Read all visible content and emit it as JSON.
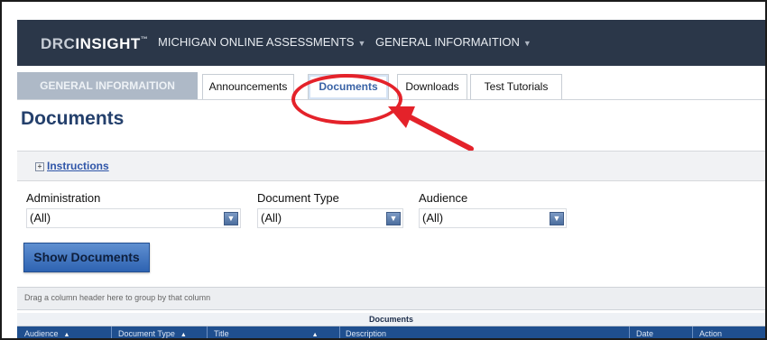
{
  "topbar": {
    "logo_drc": "DRC",
    "logo_insight": "INSIGHT",
    "logo_tm": "™",
    "nav": [
      {
        "label": "MICHIGAN ONLINE ASSESSMENTS"
      },
      {
        "label": "GENERAL INFORMAITION"
      }
    ]
  },
  "tabs": {
    "main": "GENERAL INFORMAITION",
    "items": [
      {
        "label": "Announcements"
      },
      {
        "label": "Documents",
        "active": true
      },
      {
        "label": "Downloads"
      },
      {
        "label": "Test Tutorials"
      }
    ]
  },
  "page": {
    "title": "Documents"
  },
  "instructions": {
    "label": "Instructions"
  },
  "filters": {
    "administration": {
      "label": "Administration",
      "value": "(All)"
    },
    "document_type": {
      "label": "Document Type",
      "value": "(All)"
    },
    "audience": {
      "label": "Audience",
      "value": "(All)"
    }
  },
  "show_button": "Show Documents",
  "grid": {
    "group_hint": "Drag a column header here to group by that column",
    "title": "Documents",
    "columns": [
      "Audience",
      "Document Type",
      "Title",
      "Description",
      "Date",
      "Action"
    ]
  },
  "colors": {
    "topbar": "#2b3749",
    "accent": "#2e63b2",
    "callout": "#e4222a"
  }
}
